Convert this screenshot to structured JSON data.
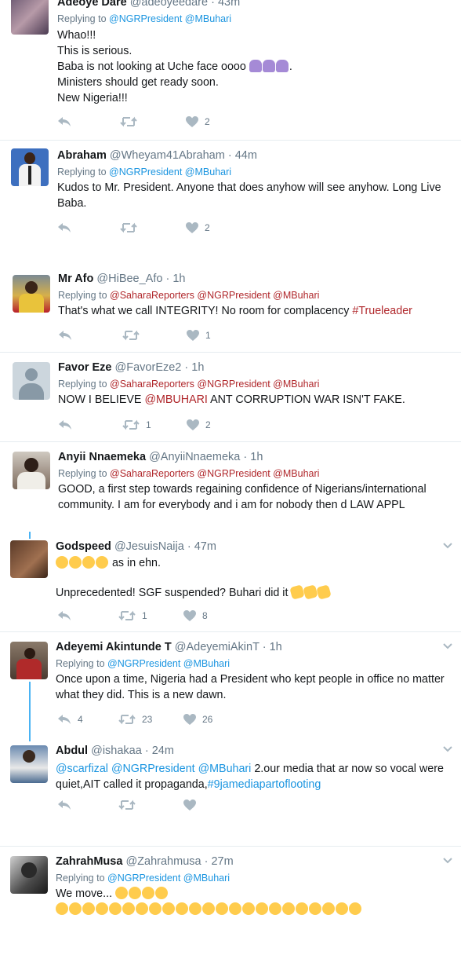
{
  "tweets": [
    {
      "name": "Adeoye Dare",
      "handle": "@adeoyeedare",
      "time": "43m",
      "reply_prefix": "Replying to",
      "reply_mentions": [
        "@NGRPresident",
        "@MBuhari"
      ],
      "lines": [
        "Whao!!!",
        "This is serious.",
        "Baba is not looking at Uche face oooo",
        "Ministers should get ready soon.",
        "New Nigeria!!!"
      ],
      "reply_count": "",
      "retweet_count": "",
      "like_count": "2"
    },
    {
      "name": "Abraham",
      "handle": "@Wheyam41Abraham",
      "time": "44m",
      "reply_prefix": "Replying to",
      "reply_mentions": [
        "@NGRPresident",
        "@MBuhari"
      ],
      "text": "Kudos to Mr. President. Anyone that does anyhow will see anyhow. Long Live Baba.",
      "reply_count": "",
      "retweet_count": "",
      "like_count": "2"
    },
    {
      "name": "Mr Afo",
      "handle": "@HiBee_Afo",
      "time": "1h",
      "reply_prefix": "Replying to",
      "reply_mentions": [
        "@SaharaReporters",
        "@NGRPresident",
        "@MBuhari"
      ],
      "text": "That's what we call INTEGRITY! No room for complacency ",
      "hashtag": "#Trueleader",
      "reply_count": "",
      "retweet_count": "",
      "like_count": "1"
    },
    {
      "name": "Favor Eze",
      "handle": "@FavorEze2",
      "time": "1h",
      "reply_prefix": "Replying to",
      "reply_mentions": [
        "@SaharaReporters",
        "@NGRPresident",
        "@MBuhari"
      ],
      "text_before": "NOW I BELIEVE ",
      "text_mention": "@MBUHARI",
      "text_after": " ANT CORRUPTION WAR ISN'T FAKE.",
      "reply_count": "",
      "retweet_count": "1",
      "like_count": "2"
    },
    {
      "name": "Anyii Nnaemeka",
      "handle": "@AnyiiNnaemeka",
      "time": "1h",
      "reply_prefix": "Replying to",
      "reply_mentions": [
        "@SaharaReporters",
        "@NGRPresident",
        "@MBuhari"
      ],
      "text": "GOOD, a first step towards regaining confidence of Nigerians/international community. I am for everybody and i am for nobody then d LAW APPL"
    },
    {
      "name": "Godspeed",
      "handle": "@JesuisNaija",
      "time": "47m",
      "line1": "as in ehn.",
      "line2": "Unprecedented! SGF suspended? Buhari did it",
      "reply_count": "",
      "retweet_count": "1",
      "like_count": "8"
    },
    {
      "name": "Adeyemi Akintunde T",
      "handle": "@AdeyemiAkinT",
      "time": "1h",
      "reply_prefix": "Replying to",
      "reply_mentions": [
        "@NGRPresident",
        "@MBuhari"
      ],
      "text": "Once upon a time, Nigeria had a President who kept people in office no matter what they did. This is a new dawn.",
      "reply_count": "4",
      "retweet_count": "23",
      "like_count": "26"
    },
    {
      "name": "Abdul",
      "handle": "@ishakaa",
      "time": "24m",
      "mentions": [
        "@scarfizal",
        "@NGRPresident",
        "@MBuhari"
      ],
      "text": " 2.our media that ar now so vocal were quiet,AIT called it propaganda,",
      "hashtag": "#9jamediapartoflooting",
      "reply_count": "",
      "retweet_count": "",
      "like_count": ""
    },
    {
      "name": "ZahrahMusa",
      "handle": "@Zahrahmusa",
      "time": "27m",
      "reply_prefix": "Replying to",
      "reply_mentions": [
        "@NGRPresident",
        "@MBuhari"
      ],
      "text": "We move..."
    }
  ]
}
